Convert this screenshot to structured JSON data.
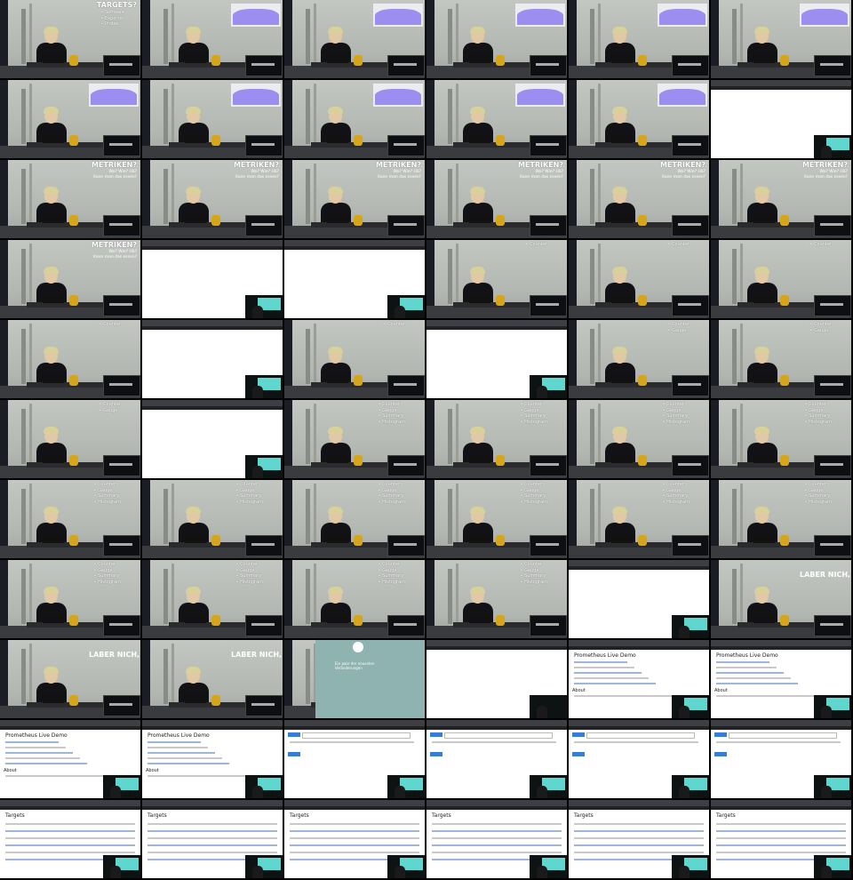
{
  "slides": {
    "targets": {
      "title": "TARGETS?",
      "items": [
        "Software",
        "Exporter",
        "Prober"
      ]
    },
    "metriken": {
      "title": "METRIKEN?",
      "lines": [
        "Wo? Wie? Hä?",
        "Kann man das essen?"
      ]
    },
    "types": [
      "Counter",
      "Gauge",
      "Summary",
      "Histogram"
    ],
    "laber": "LABER NICH, ZEIG H"
  },
  "browser": {
    "demo_title": "Prometheus Live Demo",
    "about_label": "About",
    "targets_title": "Targets",
    "intro_text": "Ein paar der neuesten Veränderungen"
  },
  "layout_hint_cells": [
    "targets",
    "chart",
    "chart",
    "chart",
    "chart",
    "chart",
    "chart",
    "chart",
    "chart",
    "chart",
    "chart",
    "plain",
    "metriken",
    "metriken",
    "metriken",
    "metriken",
    "metriken",
    "metriken",
    "metriken",
    "plain",
    "plain",
    "type1",
    "type1",
    "type1",
    "type1",
    "plain",
    "type1",
    "plain",
    "type2",
    "type2",
    "type2",
    "plain",
    "type4",
    "type4",
    "type4",
    "type4",
    "type4",
    "type4",
    "type4",
    "type4",
    "type4",
    "type4",
    "type4",
    "type4",
    "type4",
    "type4",
    "plain",
    "laber",
    "laber",
    "laber",
    "intro",
    "browser-blank",
    "demo",
    "demo",
    "demo",
    "demo",
    "graph",
    "graph",
    "graph",
    "graph",
    "targets-page",
    "targets-page",
    "targets-page",
    "targets-page",
    "targets-page",
    "targets-page"
  ]
}
